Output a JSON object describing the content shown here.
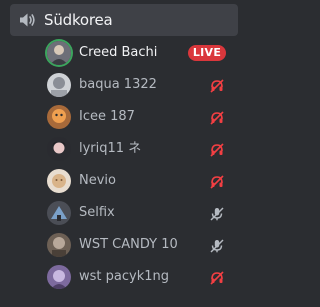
{
  "channel": {
    "name": "Südkorea",
    "icon": "speaker-icon"
  },
  "users": [
    {
      "name": "Creed Bachi",
      "badge": "LIVE",
      "avatar_colors": [
        "#3ba55d",
        "#6d6f78"
      ]
    },
    {
      "name": "baqua 1322",
      "mute_color": "#f23f43",
      "avatar_colors": [
        "#8a8e96",
        "#cfd2d6"
      ]
    },
    {
      "name": "Icee 187",
      "mute_color": "#f23f43",
      "avatar_colors": [
        "#f0a050",
        "#a86a3a"
      ]
    },
    {
      "name": "lyriq11 ネ",
      "mute_color": "#f23f43",
      "avatar_colors": [
        "#2a2b30",
        "#e9c8c8"
      ]
    },
    {
      "name": "Nevio",
      "mute_color": "#f23f43",
      "avatar_colors": [
        "#d9b48a",
        "#7c5a3a"
      ]
    },
    {
      "name": "Selfix",
      "mute_color": "#b5bac1",
      "avatar_colors": [
        "#4b4e56",
        "#7aa0c8"
      ]
    },
    {
      "name": "WST CANDY 10",
      "mute_color": "#b5bac1",
      "avatar_colors": [
        "#b8a89a",
        "#6d6055"
      ]
    },
    {
      "name": "wst pacyk1ng",
      "mute_color": "#f23f43",
      "avatar_colors": [
        "#7d6a9e",
        "#c8b8e0"
      ]
    }
  ],
  "colors": {
    "background": "#2b2d31",
    "channel_highlight": "#3f4147",
    "live_red": "#da373c",
    "mute_red": "#f23f43",
    "mute_gray": "#b5bac1"
  }
}
